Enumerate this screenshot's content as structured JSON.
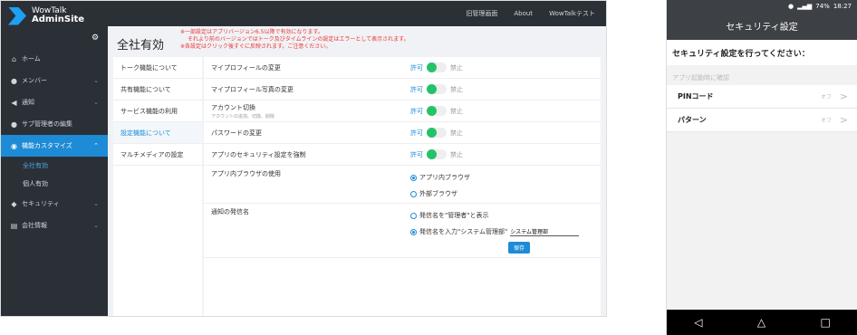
{
  "app": {
    "logo_line1": "WowTalk",
    "logo_line2": "AdminSite"
  },
  "topbar": {
    "links": [
      "旧管理画面",
      "About",
      "WowTalkテスト"
    ]
  },
  "sidebar": {
    "collapse_icon": "gear-icon",
    "items": [
      {
        "label": "ホーム",
        "icon": "home-icon"
      },
      {
        "label": "メンバー",
        "icon": "user-icon"
      },
      {
        "label": "通知",
        "icon": "megaphone-icon"
      },
      {
        "label": "サブ管理者の編集",
        "icon": "admin-icon"
      },
      {
        "label": "機能カスタマイズ",
        "icon": "toggle-icon"
      }
    ],
    "subitems": [
      {
        "label": "全社有効"
      },
      {
        "label": "個人有効"
      }
    ],
    "items2": [
      {
        "label": "セキュリティ",
        "icon": "shield-icon"
      },
      {
        "label": "会社情報",
        "icon": "building-icon"
      }
    ]
  },
  "page": {
    "title": "全社有効",
    "note1": "※一部設定はアプリバージョン6.5以降で有効になります。",
    "note2": "それより前のバージョンではトーク及びタイムラインの設定はエラーとして表示されます。",
    "note3": "※各設定はクリック後すぐに反映されます。ご注意ください。"
  },
  "tabs": [
    {
      "label": "トーク機能について"
    },
    {
      "label": "共有機能について"
    },
    {
      "label": "サービス機能の利用"
    },
    {
      "label": "設定機能について"
    },
    {
      "label": "マルチメディアの設定"
    }
  ],
  "settings": {
    "allow": "許可",
    "deny": "禁止",
    "rows": [
      {
        "label": "マイプロフィールの変更"
      },
      {
        "label": "マイプロフィール写真の変更"
      },
      {
        "label": "アカウント切換",
        "sub": "アカウントの追加、切換、削除"
      },
      {
        "label": "パスワードの変更"
      },
      {
        "label": "アプリのセキュリティ設定を強制"
      }
    ],
    "browser": {
      "label": "アプリ内ブラウザの使用",
      "opt1": "アプリ内ブラウザ",
      "opt2": "外部ブラウザ"
    },
    "sender": {
      "label": "通知の発信名",
      "opt1": "発信名を\"管理者\"と表示",
      "opt2": "発信名を入力\"システム管理部\"",
      "value": "システム管理部",
      "save": "保存"
    }
  },
  "phone": {
    "status": "18:27",
    "battery": "74%",
    "appbar": "セキュリティ設定",
    "title": "セキュリティ設定を行ってください：",
    "section": "アプリ起動時に確認",
    "rows": [
      {
        "label": "PINコード",
        "value": "オフ"
      },
      {
        "label": "パターン",
        "value": "オフ"
      }
    ],
    "nav": [
      "back-icon",
      "home-icon",
      "recents-icon"
    ]
  }
}
